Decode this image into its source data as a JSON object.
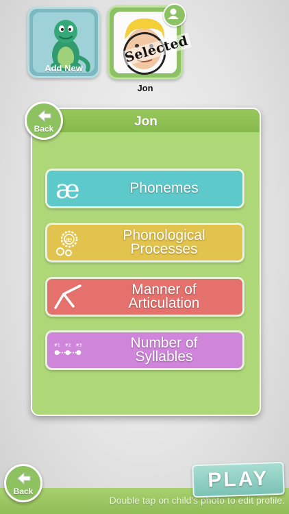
{
  "profiles": {
    "add_new_label": "Add New",
    "selected_name": "Jon",
    "selected_stamp": "Selected"
  },
  "panel": {
    "title": "Jon",
    "back_label": "Back"
  },
  "menu": [
    {
      "label_line1": "Phonemes",
      "label_line2": "",
      "icon": "ae-ligature-icon",
      "color": "#5ec9cb"
    },
    {
      "label_line1": "Phonological",
      "label_line2": "Processes",
      "icon": "gears-icon",
      "color": "#e2c34d"
    },
    {
      "label_line1": "Manner of",
      "label_line2": "Articulation",
      "icon": "articulation-icon",
      "color": "#e5716d"
    },
    {
      "label_line1": "Number of",
      "label_line2": "Syllables",
      "icon": "syllables-icon",
      "color": "#cf86da"
    }
  ],
  "footer": {
    "back_label": "Back",
    "play_label": "PLAY",
    "hint": "Double tap on child's photo to edit profile."
  },
  "syllable_icon": {
    "n1": "#1",
    "n2": "#2",
    "n3": "#3"
  },
  "ae_glyph": "æ"
}
